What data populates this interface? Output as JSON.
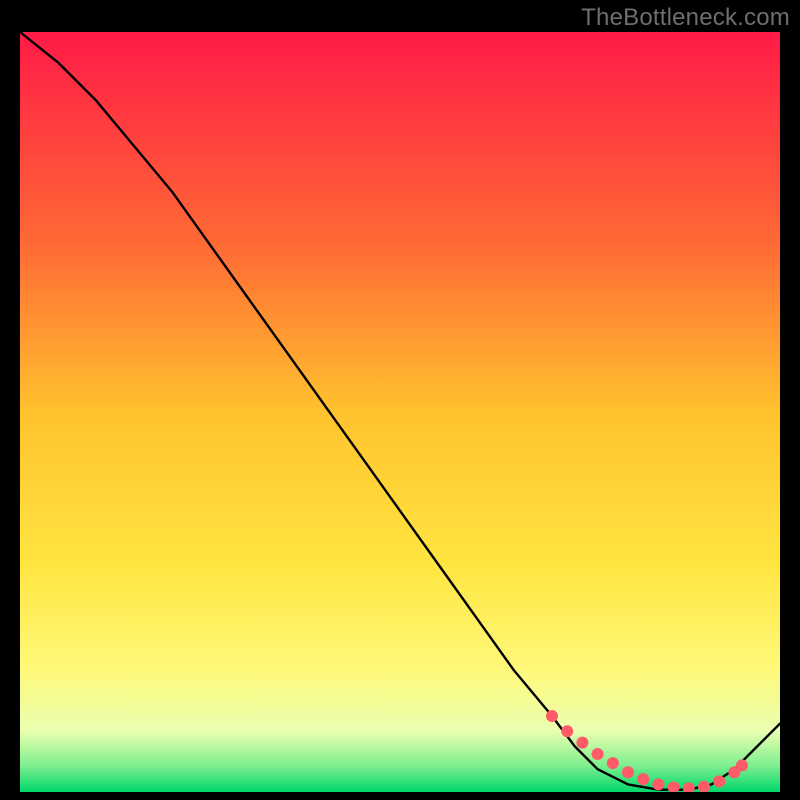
{
  "watermark": "TheBottleneck.com",
  "chart_data": {
    "type": "line",
    "title": "",
    "xlabel": "",
    "ylabel": "",
    "xlim": [
      0,
      100
    ],
    "ylim": [
      0,
      100
    ],
    "grid": false,
    "legend": false,
    "background_gradient": {
      "top": "#ff1a47",
      "mid_upper": "#ff7a2a",
      "mid": "#ffe540",
      "mid_lower": "#fff97a",
      "band": "#e9ffb0",
      "bottom": "#00d66b"
    },
    "curve": {
      "x": [
        0,
        5,
        10,
        15,
        20,
        25,
        30,
        35,
        40,
        45,
        50,
        55,
        60,
        65,
        70,
        73,
        76,
        80,
        84,
        88,
        91,
        94,
        97,
        100
      ],
      "y": [
        100,
        96,
        91,
        85,
        79,
        72,
        65,
        58,
        51,
        44,
        37,
        30,
        23,
        16,
        10,
        6,
        3,
        1,
        0.3,
        0.3,
        1,
        3,
        6,
        9
      ]
    },
    "markers": {
      "x": [
        70,
        72,
        74,
        76,
        78,
        80,
        82,
        84,
        86,
        88,
        90,
        92,
        94,
        95
      ],
      "y": [
        10,
        8,
        6.5,
        5,
        3.8,
        2.6,
        1.7,
        1.0,
        0.6,
        0.5,
        0.7,
        1.4,
        2.6,
        3.5
      ],
      "color": "#ff5a68",
      "radius": 6
    }
  }
}
